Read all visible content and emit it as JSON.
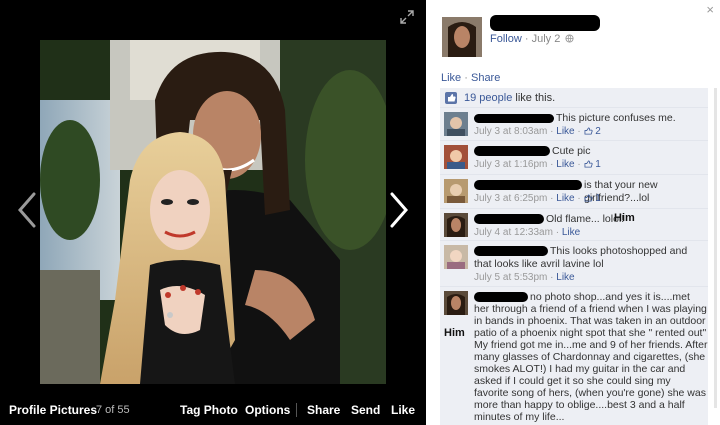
{
  "viewer": {
    "album_name": "Profile Pictures",
    "position_text": "7 of 55",
    "bottom_actions": [
      "Tag Photo",
      "Options",
      "Share",
      "Send",
      "Like"
    ],
    "close_glyph": "×"
  },
  "post": {
    "follow_label": "Follow",
    "separator": "·",
    "date": "July 2",
    "actions": [
      "Like",
      "Share"
    ],
    "likes_count_text": "19 people",
    "likes_suffix": "like this."
  },
  "comments": [
    {
      "text": "This picture confuses me.",
      "time": "July 3 at 8:03am",
      "like_label": "Like",
      "like_count": "2"
    },
    {
      "text": "Cute pic",
      "time": "July 3 at 1:16pm",
      "like_label": "Like",
      "like_count": "1"
    },
    {
      "text": "is that your new girlfriend?...lol",
      "time": "July 3 at 6:25pm",
      "like_label": "Like",
      "like_count": "1"
    },
    {
      "text": "Old flame... lolol!",
      "time": "July 4 at 12:33am",
      "like_label": "Like",
      "annotation": "Him"
    },
    {
      "text_line1": "This looks photoshopped and",
      "text_line2": "that looks like avril lavine lol",
      "time": "July 5 at 5:53pm",
      "like_label": "Like"
    },
    {
      "text_line1": "no photo shop...and yes it is....met",
      "lines": [
        "her through a friend of a friend when I was playing",
        "in bands in phoenix. That was taken in an outdoor",
        "patio of a phoenix night spot that she \" rented out\"",
        "My friend got me in...me and 9 of her friends. After",
        "many glasses of Chardonnay and cigarettes, (she",
        "smokes ALOT!) I had my guitar in the car and",
        "asked if I could get it so she could sing my",
        "favorite song of hers, (when you're gone) she was",
        "more than happy to oblige....best 3 and a half",
        "minutes of my life..."
      ],
      "annotation": "Him"
    }
  ],
  "colors": {
    "link": "#3b5998",
    "panel_bg": "#edeff4",
    "stage_bg": "#000000"
  },
  "icons": [
    "expand-icon",
    "close-icon",
    "chevron-left-icon",
    "chevron-right-icon",
    "globe-icon",
    "like-thumb-icon"
  ]
}
